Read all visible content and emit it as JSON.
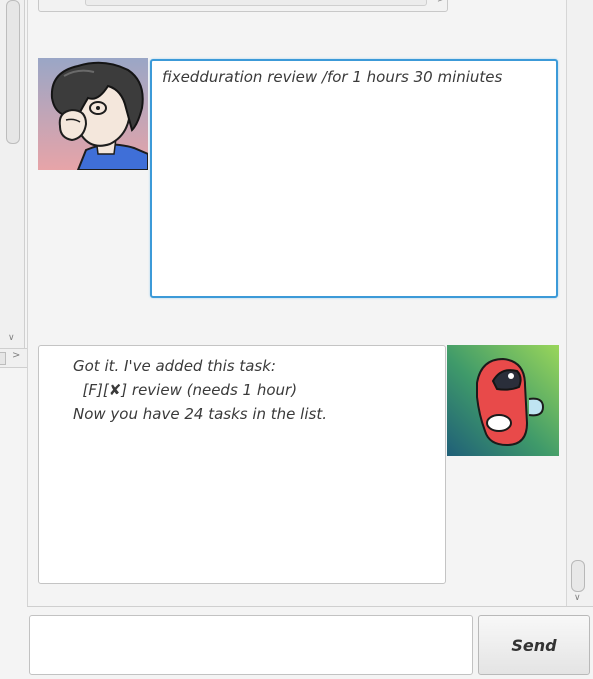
{
  "dialog": {
    "user_message": "fixedduration review /for 1 hours 30 miniutes",
    "bot_reply": "Got it. I've added this task:\n  [F][✘] review (needs 1 hour)\nNow you have 24 tasks in the list."
  },
  "input": {
    "value": "",
    "placeholder": ""
  },
  "send_button": {
    "label": "Send"
  },
  "icons": {
    "user_avatar": "user-avatar-illustration",
    "bot_avatar": "bot-avatar-illustration",
    "scroll_down": "chevron-down-icon",
    "scroll_right": "chevron-right-icon"
  },
  "colors": {
    "focus_border": "#3c9ad8",
    "bot_avatar_bg_start": "#9ad65a",
    "bot_avatar_bg_end": "#1f6a78",
    "bot_body": "#e84a4a",
    "user_avatar_bg": "#e7a4a8",
    "user_shirt": "#3f6fd8"
  }
}
